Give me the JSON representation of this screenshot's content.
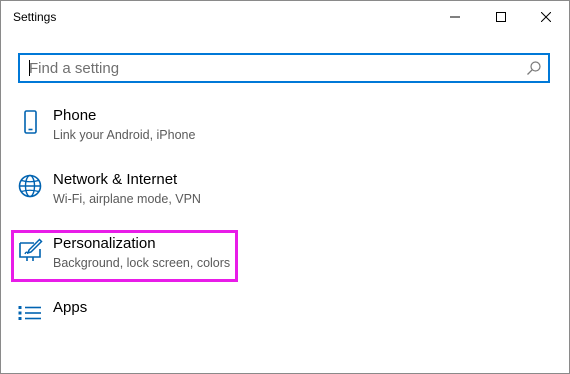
{
  "window": {
    "title": "Settings"
  },
  "titlebar_buttons": {
    "minimize_icon": "minimize-icon",
    "maximize_icon": "maximize-icon",
    "close_icon": "close-icon"
  },
  "search": {
    "placeholder": "Find a setting",
    "value": "",
    "icon": "search-icon"
  },
  "items": [
    {
      "label": "Phone",
      "description": "Link your Android, iPhone",
      "icon": "phone-icon"
    },
    {
      "label": "Network & Internet",
      "description": "Wi-Fi, airplane mode, VPN",
      "icon": "globe-icon"
    },
    {
      "label": "Personalization",
      "description": "Background, lock screen, colors",
      "icon": "personalization-icon"
    },
    {
      "label": "Apps",
      "description": "",
      "icon": "apps-list-icon"
    }
  ],
  "colors": {
    "accent": "#0078d7",
    "highlight": "#e81ce8",
    "description_text": "#5a5a5a"
  }
}
